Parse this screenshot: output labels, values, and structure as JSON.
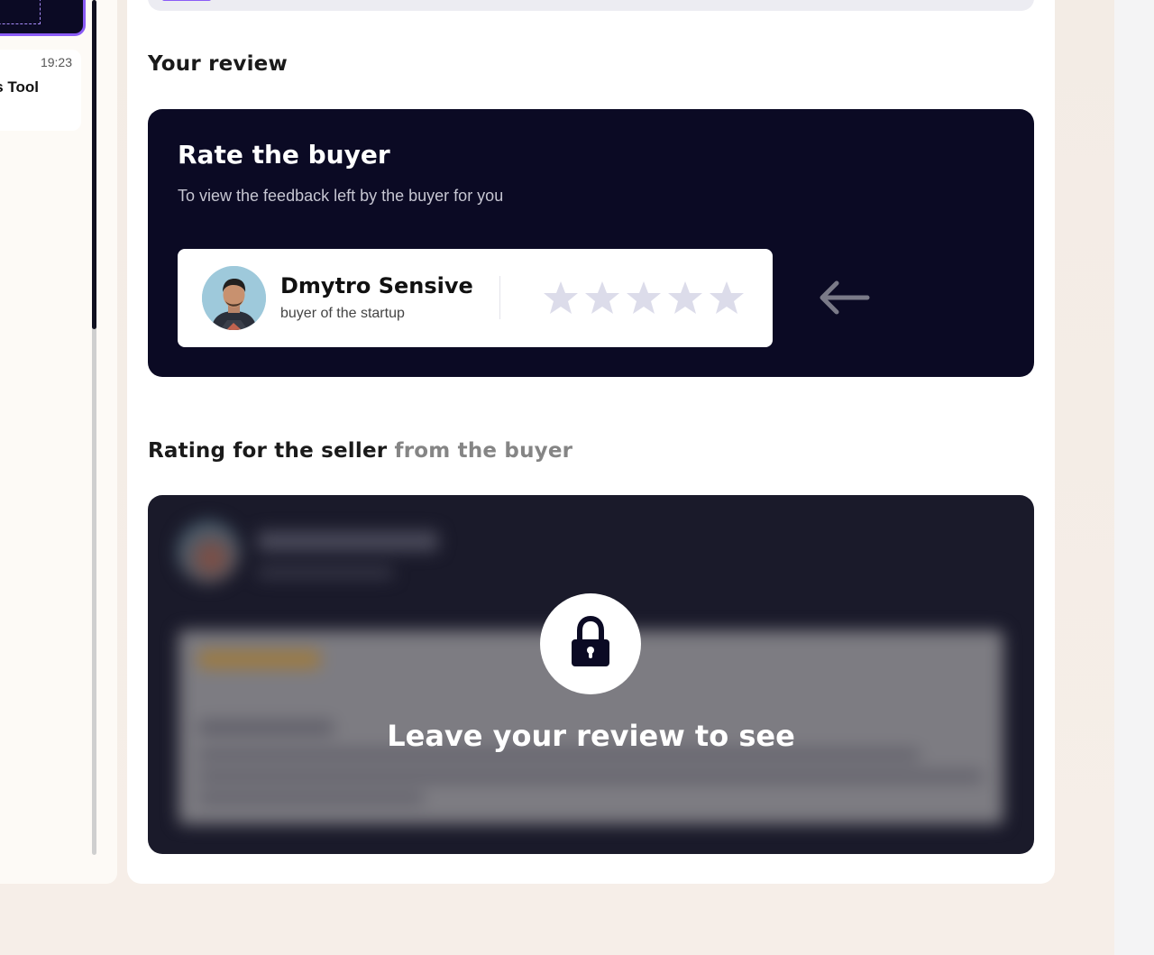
{
  "chat_list": {
    "item": {
      "time": "19:23",
      "title": "s Tool"
    }
  },
  "review": {
    "your_review_title": "Your review",
    "card": {
      "title": "Rate the buyer",
      "subtitle": "To view the feedback left by the buyer for you",
      "buyer": {
        "name": "Dmytro Sensive",
        "role": "buyer of the startup"
      },
      "stars_selected": 0,
      "stars_total": 5
    }
  },
  "seller_rating": {
    "title_main": "Rating for the seller",
    "title_muted": "from the buyer",
    "locked_text": "Leave your review to see"
  },
  "colors": {
    "dark_card": "#0b0a24",
    "accent": "#8b5cf6",
    "star_empty": "#dcdcea"
  }
}
